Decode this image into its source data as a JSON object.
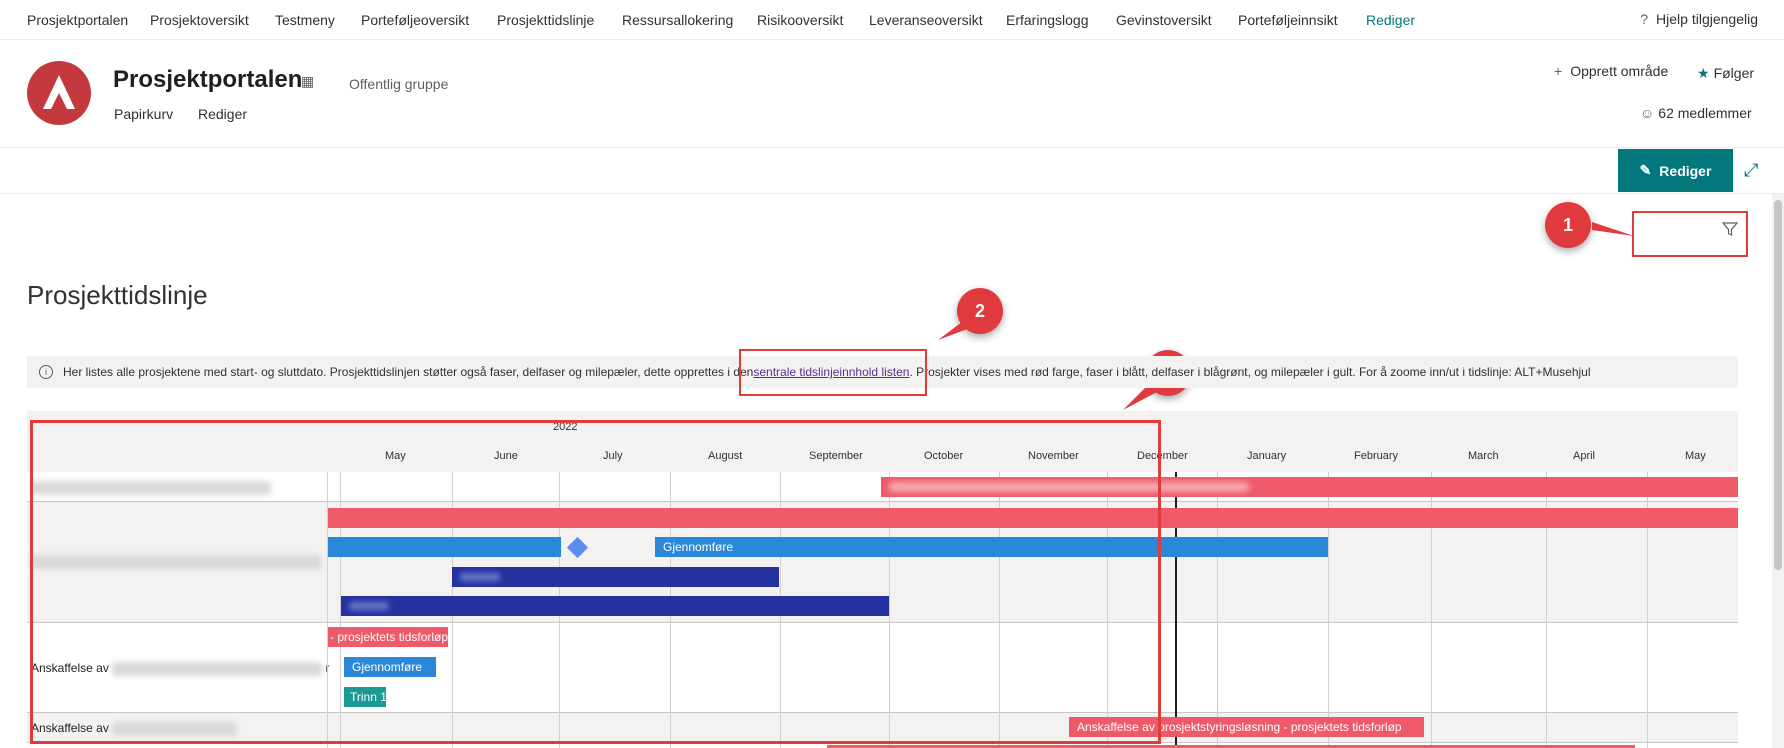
{
  "topnav": {
    "items": [
      "Prosjektportalen",
      "Prosjektoversikt",
      "Testmeny",
      "Porteføljeoversikt",
      "Prosjekttidslinje",
      "Ressursallokering",
      "Risikooversikt",
      "Leveranseoversikt",
      "Erfaringslogg",
      "Gevinstoversikt",
      "Porteføljeinnsikt",
      "Rediger"
    ],
    "help": "Hjelp tilgjengelig"
  },
  "site": {
    "title": "Prosjektportalen",
    "group_type": "Offentlig gruppe",
    "links": [
      "Papirkurv",
      "Rediger"
    ],
    "create_site": "Opprett område",
    "follow": "Følger",
    "members": "62 medlemmer",
    "brand_color": "#c4393e"
  },
  "cmdbar": {
    "edit_label": "Rediger",
    "accent": "#03787c"
  },
  "callouts": [
    "1",
    "2",
    "3"
  ],
  "page": {
    "heading": "Prosjekttidslinje",
    "info_prefix": "Her listes alle prosjektene med start- og sluttdato. Prosjekttidslinjen støtter også faser, delfaser og milepæler, dette opprettes i den ",
    "info_link": "sentrale tidslinjeinnhold listen",
    "info_suffix": ". Prosjekter vises med rød farge, faser i blått, delfaser i blågrønt, og milepæler i gult. For å zoome inn/ut i tidslinje: ALT+Musehjul"
  },
  "timeline": {
    "year": "2022",
    "months": [
      "May",
      "June",
      "July",
      "August",
      "September",
      "October",
      "November",
      "December",
      "January",
      "February",
      "March",
      "April",
      "May"
    ],
    "rows": [
      {
        "label": ""
      },
      {
        "label": ""
      },
      {
        "label": "Anskaffelse av",
        "suffix": "r"
      },
      {
        "label": "Anskaffelse av"
      }
    ],
    "bars": {
      "row3_project": "- prosjektets tidsforløp",
      "row2_phase": "Gjennomføre",
      "row3_phase": "Gjennomføre",
      "row3_subphase": "Trinn 1",
      "row4_project": "Anskaffelse av prosjektstyringsløsning - prosjektets tidsforløp"
    },
    "colors": {
      "project": "#ee5a6a",
      "phase": "#2b88d8",
      "subphase_dark": "#2432a0",
      "subphase": "#1b9a93",
      "milestone": "#5b8def"
    }
  }
}
